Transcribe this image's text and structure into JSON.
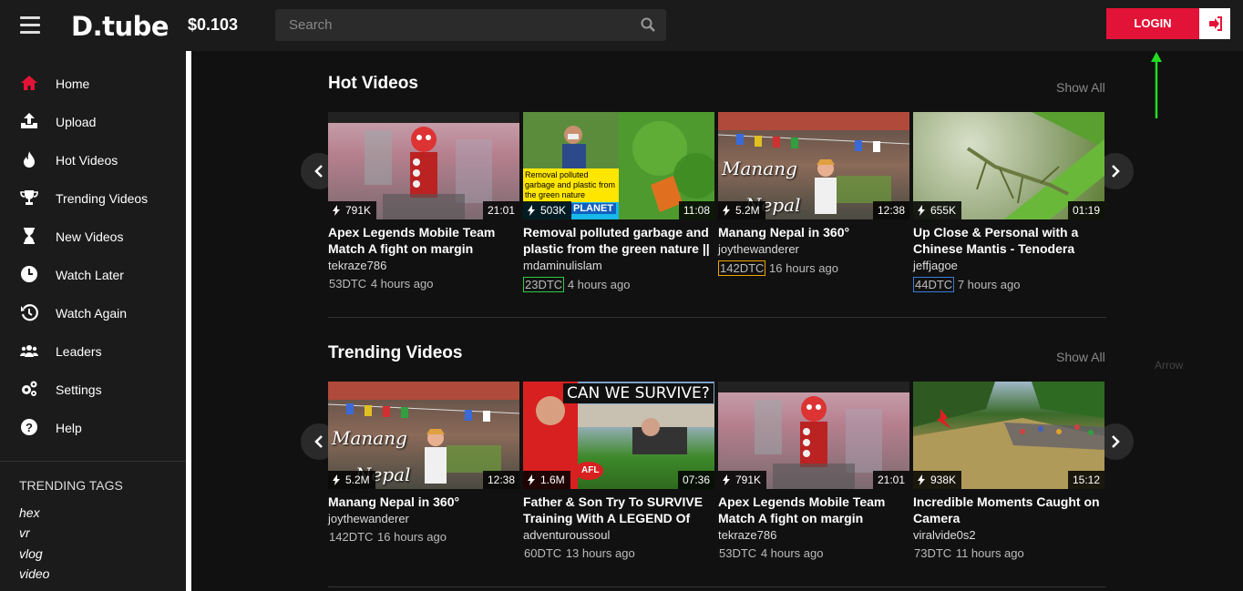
{
  "header": {
    "logo": "D.tube",
    "price": "$0.103",
    "search_placeholder": "Search",
    "login_label": "LOGIN"
  },
  "annotation": {
    "arrow_label": "Arrow"
  },
  "sidebar": {
    "items": [
      {
        "label": "Home",
        "icon": "home-icon"
      },
      {
        "label": "Upload",
        "icon": "upload-icon"
      },
      {
        "label": "Hot Videos",
        "icon": "fire-icon"
      },
      {
        "label": "Trending Videos",
        "icon": "trophy-icon"
      },
      {
        "label": "New Videos",
        "icon": "hourglass-icon"
      },
      {
        "label": "Watch Later",
        "icon": "clock-icon"
      },
      {
        "label": "Watch Again",
        "icon": "history-icon"
      },
      {
        "label": "Leaders",
        "icon": "users-icon"
      },
      {
        "label": "Settings",
        "icon": "gears-icon"
      },
      {
        "label": "Help",
        "icon": "question-icon"
      }
    ],
    "trending_title": "TRENDING TAGS",
    "tags": [
      "hex",
      "vr",
      "vlog",
      "video"
    ]
  },
  "sections": {
    "hot": {
      "title": "Hot Videos",
      "show_all": "Show All",
      "videos": [
        {
          "views": "791K",
          "duration": "21:01",
          "title": "Apex Legends Mobile Team Match A fight on margin",
          "author": "tekraze786",
          "dtc": "53DTC",
          "time": "4 hours ago"
        },
        {
          "views": "503K",
          "duration": "11:08",
          "title": "Removal polluted garbage and plastic from the green nature ||",
          "author": "mdaminulislam",
          "dtc": "23DTC",
          "time": "4 hours ago"
        },
        {
          "views": "5.2M",
          "duration": "12:38",
          "title": "Manang Nepal in 360°",
          "author": "joythewanderer",
          "dtc": "142DTC",
          "time": "16 hours ago"
        },
        {
          "views": "655K",
          "duration": "01:19",
          "title": "Up Close & Personal with a Chinese Mantis - Tenodera",
          "author": "jeffjagoe",
          "dtc": "44DTC",
          "time": "7 hours ago"
        }
      ]
    },
    "trending": {
      "title": "Trending Videos",
      "show_all": "Show All",
      "videos": [
        {
          "views": "5.2M",
          "duration": "12:38",
          "title": "Manang Nepal in 360°",
          "author": "joythewanderer",
          "dtc": "142DTC",
          "time": "16 hours ago"
        },
        {
          "views": "1.6M",
          "duration": "07:36",
          "title": "Father & Son Try To SURVIVE Training With A LEGEND Of AFL",
          "author": "adventuroussoul",
          "dtc": "60DTC",
          "time": "13 hours ago"
        },
        {
          "views": "791K",
          "duration": "21:01",
          "title": "Apex Legends Mobile Team Match A fight on margin",
          "author": "tekraze786",
          "dtc": "53DTC",
          "time": "4 hours ago"
        },
        {
          "views": "938K",
          "duration": "15:12",
          "title": "Incredible Moments Caught on Camera",
          "author": "viralvide0s2",
          "dtc": "73DTC",
          "time": "11 hours ago"
        }
      ]
    }
  },
  "thumb_text": {
    "removal": "Removal polluted garbage and plastic from the green nature",
    "planet": "PLANET",
    "manang": "Manang",
    "nepal": "Nepal",
    "survive": "CAN WE SURVIVE?",
    "afl": "AFL"
  },
  "colors": {
    "accent": "#e31337",
    "annotation_arrow": "#22dd22"
  }
}
